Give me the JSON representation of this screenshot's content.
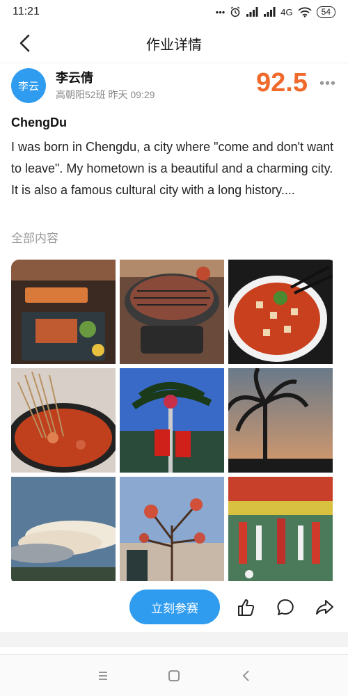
{
  "status_bar": {
    "time": "11:21",
    "dots": "•••",
    "network": "4G",
    "battery": "54"
  },
  "nav": {
    "title": "作业详情",
    "back_icon": "chevron-left-icon"
  },
  "author": {
    "avatar_text": "李云",
    "name": "李云倩",
    "meta": "高朝阳52班 昨天 09:29",
    "score": "92.5",
    "more": "•••"
  },
  "post": {
    "title": "ChengDu",
    "body": "I was born in Chengdu, a city where \"come and don't want to leave\". My hometown is a beautiful and a charming city. It is also a famous cultural city with a long history....",
    "full_link": "全部内容"
  },
  "photos": [
    {
      "name": "photo-food-platter"
    },
    {
      "name": "photo-grill-meat"
    },
    {
      "name": "photo-spicy-tofu"
    },
    {
      "name": "photo-skewer-hotpot"
    },
    {
      "name": "photo-palm-tree-flags"
    },
    {
      "name": "photo-palm-sunset"
    },
    {
      "name": "photo-cloudy-sky"
    },
    {
      "name": "photo-blossom-tree"
    },
    {
      "name": "photo-stadium-performance"
    }
  ],
  "actions": {
    "join_label": "立刻参赛",
    "like_icon": "thumbs-up-icon",
    "comment_icon": "comment-bubble-icon",
    "share_icon": "share-arrow-icon"
  },
  "system_nav": {
    "menu_icon": "menu-icon",
    "home_icon": "home-square-icon",
    "back_icon": "back-triangle-icon"
  },
  "colors": {
    "accent": "#2f9cf0",
    "score": "#f06a2c"
  }
}
